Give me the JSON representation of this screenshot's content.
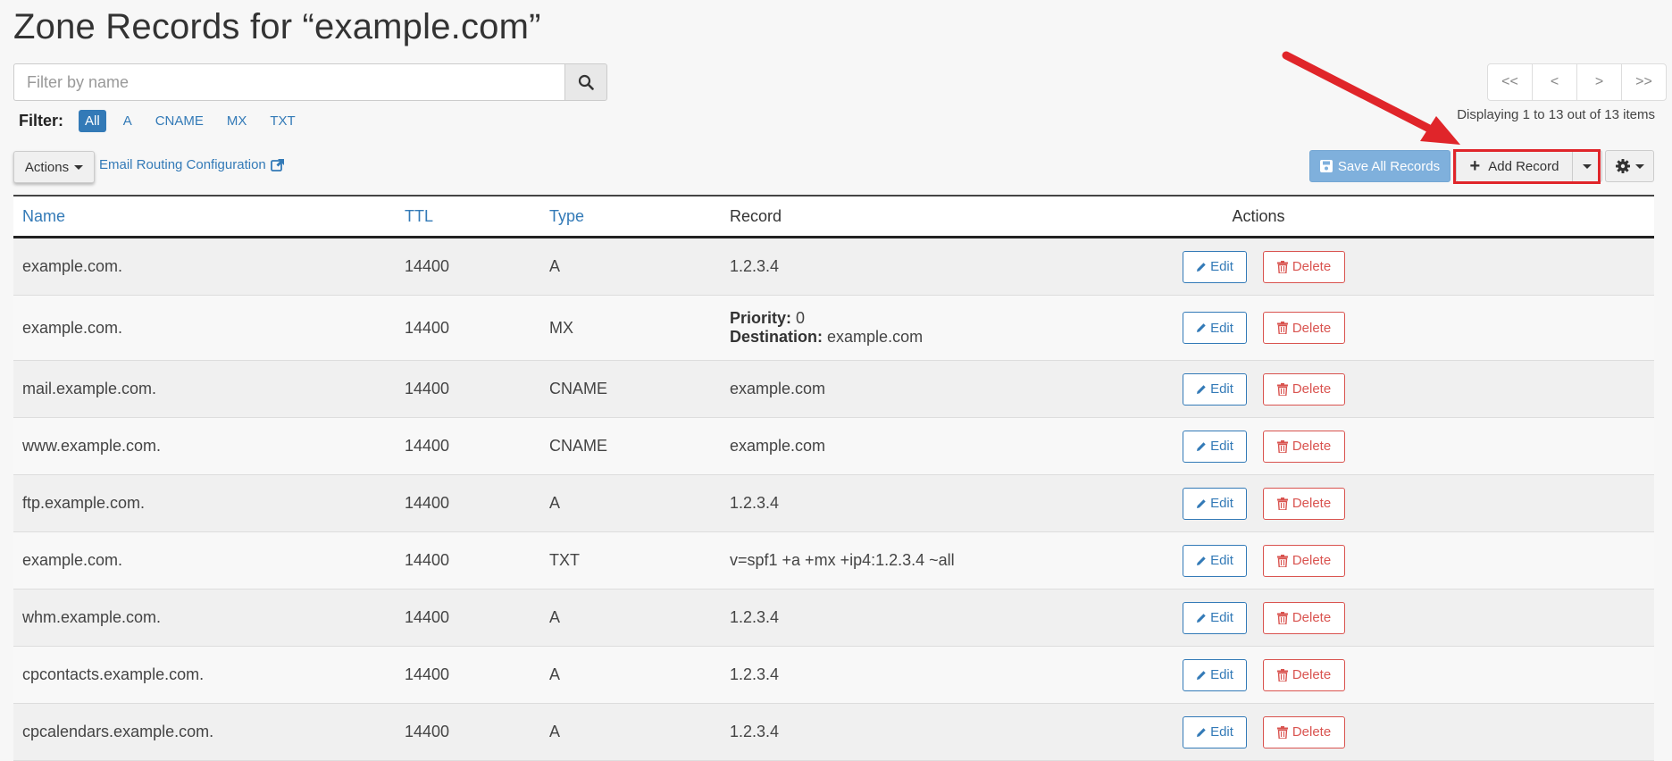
{
  "page": {
    "title": "Zone Records for “example.com”"
  },
  "search": {
    "placeholder": "Filter by name",
    "icon": "search-icon"
  },
  "filter": {
    "label": "Filter:",
    "options": [
      "All",
      "A",
      "CNAME",
      "MX",
      "TXT"
    ],
    "selected": "All"
  },
  "pager": {
    "first": "<<",
    "prev": "<",
    "next": ">",
    "last": ">>"
  },
  "display_info": "Displaying 1 to 13 out of 13 items",
  "toolbar": {
    "actions_label": "Actions",
    "email_routing_label": "Email Routing Configuration",
    "save_all_label": "Save All Records",
    "add_record_label": "Add Record"
  },
  "table": {
    "headers": {
      "name": "Name",
      "ttl": "TTL",
      "type": "Type",
      "record": "Record",
      "actions": "Actions"
    },
    "edit_label": "Edit",
    "delete_label": "Delete",
    "priority_label": "Priority:",
    "destination_label": "Destination:",
    "rows": [
      {
        "name": "example.com.",
        "ttl": "14400",
        "type": "A",
        "record": "1.2.3.4"
      },
      {
        "name": "example.com.",
        "ttl": "14400",
        "type": "MX",
        "priority": "0",
        "destination": "example.com"
      },
      {
        "name": "mail.example.com.",
        "ttl": "14400",
        "type": "CNAME",
        "record": "example.com"
      },
      {
        "name": "www.example.com.",
        "ttl": "14400",
        "type": "CNAME",
        "record": "example.com"
      },
      {
        "name": "ftp.example.com.",
        "ttl": "14400",
        "type": "A",
        "record": "1.2.3.4"
      },
      {
        "name": "example.com.",
        "ttl": "14400",
        "type": "TXT",
        "record": "v=spf1 +a +mx +ip4:1.2.3.4 ~all"
      },
      {
        "name": "whm.example.com.",
        "ttl": "14400",
        "type": "A",
        "record": "1.2.3.4"
      },
      {
        "name": "cpcontacts.example.com.",
        "ttl": "14400",
        "type": "A",
        "record": "1.2.3.4"
      },
      {
        "name": "cpcalendars.example.com.",
        "ttl": "14400",
        "type": "A",
        "record": "1.2.3.4"
      }
    ]
  },
  "colors": {
    "link": "#337ab7",
    "danger": "#d9534f",
    "save_button": "#7fb0dc",
    "annotation": "#e0252a"
  }
}
